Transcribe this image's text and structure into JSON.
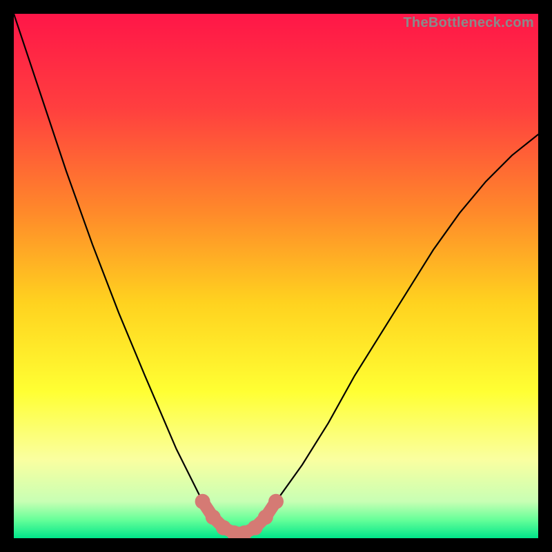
{
  "watermark": "TheBottleneck.com",
  "chart_data": {
    "type": "line",
    "title": "",
    "xlabel": "",
    "ylabel": "",
    "xlim": [
      0,
      100
    ],
    "ylim": [
      0,
      100
    ],
    "grid": false,
    "legend": false,
    "series": [
      {
        "name": "bottleneck-curve",
        "x": [
          0,
          5,
          10,
          15,
          20,
          25,
          28,
          31,
          34,
          36,
          38,
          40,
          42,
          44,
          46,
          48,
          50,
          55,
          60,
          65,
          70,
          75,
          80,
          85,
          90,
          95,
          100
        ],
        "y": [
          100,
          85,
          70,
          56,
          43,
          31,
          24,
          17,
          11,
          7,
          4,
          2,
          1,
          1,
          2,
          4,
          7,
          14,
          22,
          31,
          39,
          47,
          55,
          62,
          68,
          73,
          77
        ]
      }
    ],
    "highlight": {
      "name": "optimal-range",
      "x": [
        36,
        38,
        40,
        42,
        44,
        46,
        48,
        50
      ],
      "y": [
        7,
        4,
        2,
        1,
        1,
        2,
        4,
        7
      ]
    },
    "background_gradient": {
      "stops": [
        {
          "pos": 0.0,
          "color": "#ff1648"
        },
        {
          "pos": 0.18,
          "color": "#ff3f3f"
        },
        {
          "pos": 0.38,
          "color": "#ff8a2a"
        },
        {
          "pos": 0.55,
          "color": "#ffd21f"
        },
        {
          "pos": 0.72,
          "color": "#ffff33"
        },
        {
          "pos": 0.85,
          "color": "#faffa0"
        },
        {
          "pos": 0.93,
          "color": "#c8ffb4"
        },
        {
          "pos": 0.965,
          "color": "#66ff99"
        },
        {
          "pos": 1.0,
          "color": "#00e68a"
        }
      ]
    }
  }
}
